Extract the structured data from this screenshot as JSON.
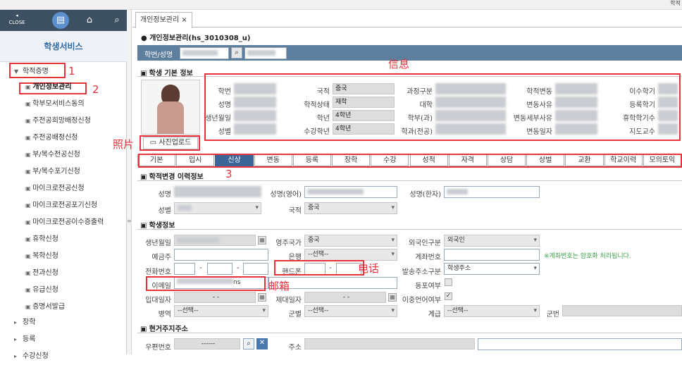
{
  "top_right": "학적",
  "sidebar": {
    "close_label": "CLOSE",
    "title": "학생서비스",
    "group1": "학적증명",
    "items": [
      {
        "label": "개인정보관리"
      },
      {
        "label": "학부모서비스동의"
      },
      {
        "label": "주전공희망배정신청"
      },
      {
        "label": "주전공배정신청"
      },
      {
        "label": "부/복수전공신청"
      },
      {
        "label": "부/복수포기신청"
      },
      {
        "label": "마이크로전공신청"
      },
      {
        "label": "마이크로전공포기신청"
      },
      {
        "label": "마이크로전공이수증출력"
      },
      {
        "label": "휴학신청"
      },
      {
        "label": "복학신청"
      },
      {
        "label": "전과신청"
      },
      {
        "label": "유급신청"
      },
      {
        "label": "증명서발급"
      }
    ],
    "group2": "장학",
    "group3": "등록",
    "group4": "수강신청"
  },
  "tab": {
    "label": "개인정보관리 ×"
  },
  "page_title": "개인정보관리(hs_3010308_u)",
  "search": {
    "label": "학번/성명"
  },
  "annotations": {
    "a1": "1",
    "a2": "2",
    "a3": "3",
    "info": "信息",
    "photo": "照片",
    "phone": "电话",
    "email": "邮箱"
  },
  "basic": {
    "title": "학생 기본 정보",
    "photo_button": "사진업로드",
    "labels": {
      "id": "학번",
      "name": "성명",
      "birth": "생년월일",
      "gender": "성별",
      "nation": "국적",
      "status": "학적상태",
      "grade": "학년",
      "course_grade": "수강학년",
      "course_type": "과정구분",
      "college": "대학",
      "dept": "학부(과)",
      "major": "학과(전공)",
      "change": "학적변동",
      "change_reason": "변동사유",
      "change_detail": "변동세부사유",
      "change_date": "변동일자",
      "completed": "이수학기",
      "registered": "등록학기",
      "leave": "휴학학기수",
      "advisor": "지도교수"
    },
    "values": {
      "nation": "중국",
      "status": "재학",
      "grade": "4학년",
      "course_grade": "4학년"
    }
  },
  "section_tabs": [
    "기본",
    "입시",
    "신상",
    "변동",
    "등록",
    "장학",
    "수강",
    "성적",
    "자격",
    "상담",
    "상벌",
    "교환",
    "학교이력",
    "모의토익"
  ],
  "history": {
    "title": "학적변경 이력정보",
    "name_label": "성명",
    "name_en_label": "성명(영어)",
    "name_hanja_label": "성명(한자)",
    "gender_label": "성별",
    "nation_label": "국적",
    "nation_value": "중국"
  },
  "student": {
    "title": "학생정보",
    "birth": "생년월일",
    "home_country": "영주국가",
    "home_country_value": "중국",
    "foreign_type": "외국인구분",
    "foreign_type_value": "외국인",
    "depositor": "예금주",
    "bank": "은행",
    "bank_value": "--선택--",
    "account": "계좌번호",
    "account_note": "※계좌번호는 암호화 처리됩니다.",
    "phone": "전화번호",
    "mobile": "핸드폰",
    "mail_type": "발송주소구분",
    "mail_type_value": "학생주소",
    "email": "이메일",
    "email_value": "ns",
    "alumni": "동포여부",
    "enlist_date": "입대일자",
    "enlist_value": "- -",
    "discharge_date": "제대일자",
    "discharge_value": "- -",
    "bilingual": "이중언어여부",
    "bilingual_check": "✓",
    "army_type": "병역",
    "army_type_value": "--선택--",
    "army_branch": "군별",
    "army_branch_value": "--선택--",
    "rank": "계급",
    "rank_value": "--선택--",
    "army_no": "군번",
    "dash": "-"
  },
  "address": {
    "title": "현거주지주소",
    "zip": "우편번호",
    "zip_value": "------",
    "addr": "주소"
  }
}
